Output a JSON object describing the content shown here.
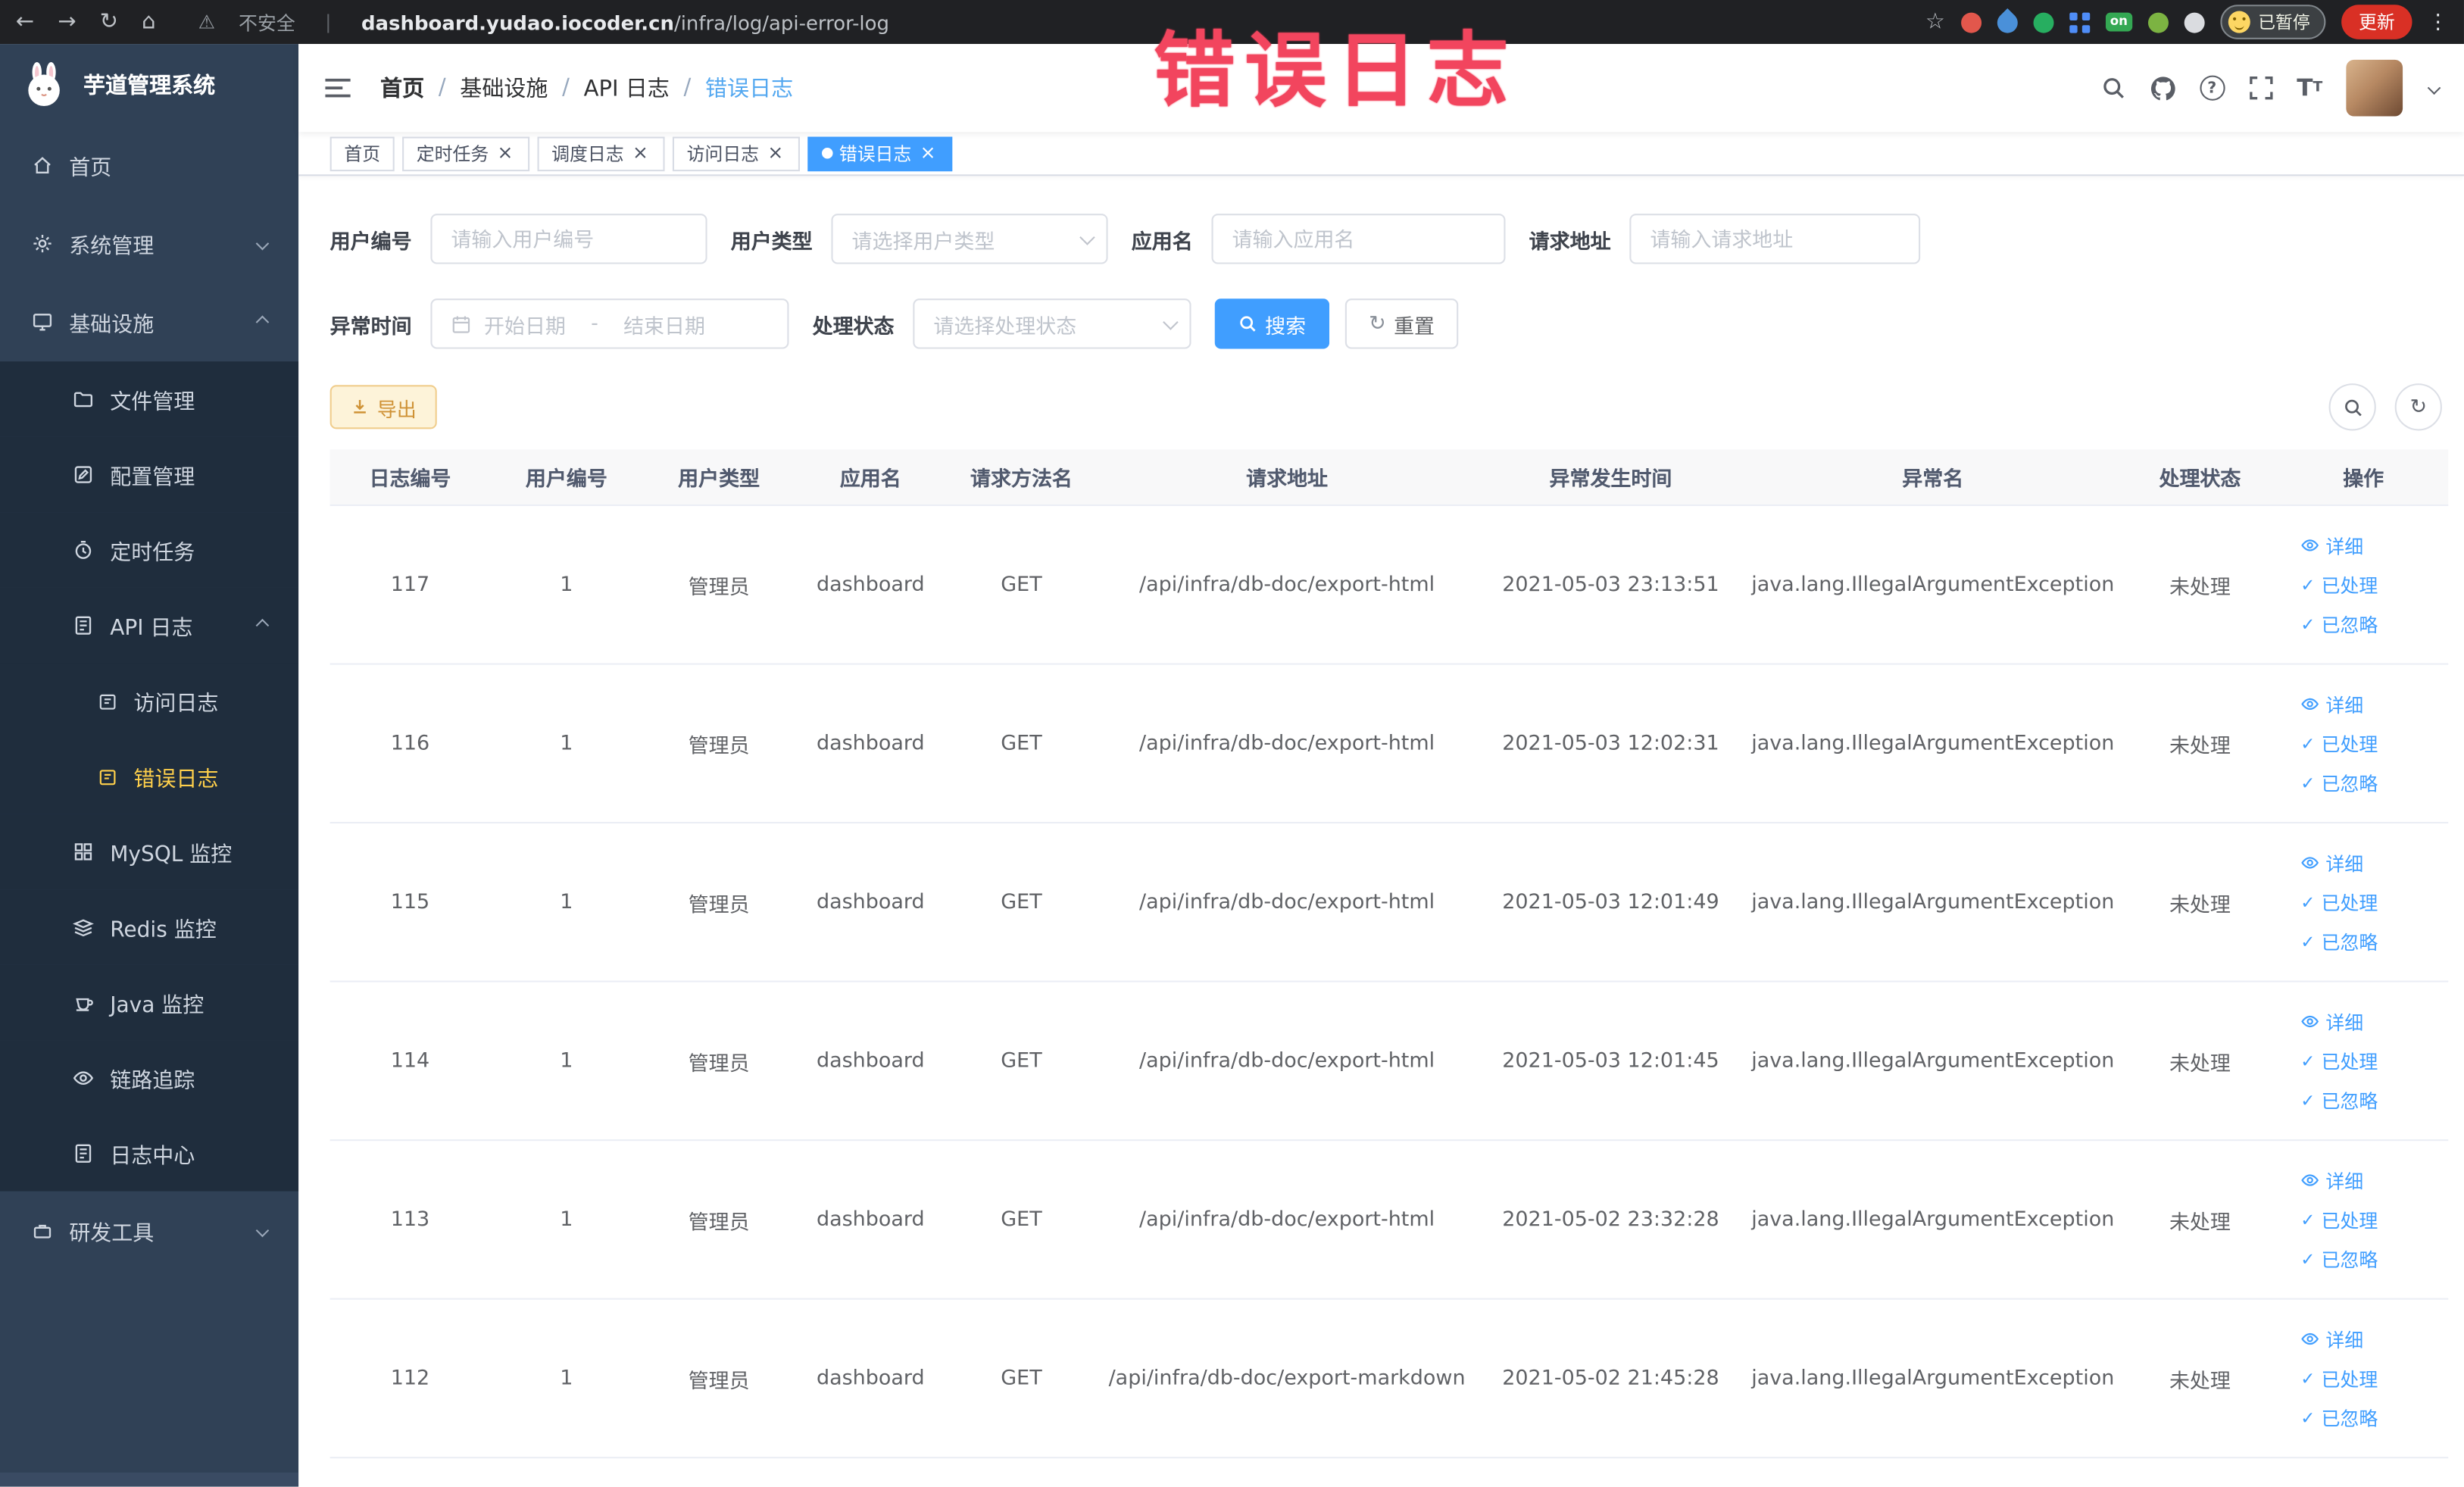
{
  "browser": {
    "security_label": "不安全",
    "url_domain": "dashboard.yudao.iocoder.cn",
    "url_path": "/infra/log/api-error-log",
    "paused_badge": "已暂停",
    "update_button": "更新",
    "extension_on_badge": "on"
  },
  "glyphs": {
    "back": "←",
    "forward": "→",
    "refresh": "↻",
    "home": "⌂",
    "warning": "⚠",
    "star": "☆",
    "menu_dots": "⋮",
    "close": "×",
    "check": "✓",
    "question": "?",
    "t": "T",
    "bar": "|"
  },
  "sidebar": {
    "logo_title": "芋道管理系统",
    "items": [
      {
        "label": "首页"
      },
      {
        "label": "系统管理"
      },
      {
        "label": "基础设施"
      },
      {
        "label": "文件管理"
      },
      {
        "label": "配置管理"
      },
      {
        "label": "定时任务"
      },
      {
        "label": "API 日志"
      },
      {
        "label": "访问日志"
      },
      {
        "label": "错误日志"
      },
      {
        "label": "MySQL 监控"
      },
      {
        "label": "Redis 监控"
      },
      {
        "label": "Java 监控"
      },
      {
        "label": "链路追踪"
      },
      {
        "label": "日志中心"
      },
      {
        "label": "研发工具"
      }
    ]
  },
  "header": {
    "breadcrumb": [
      "首页",
      "基础设施",
      "API 日志",
      "错误日志"
    ],
    "separator": "/"
  },
  "tabs": [
    {
      "label": "首页"
    },
    {
      "label": "定时任务"
    },
    {
      "label": "调度日志"
    },
    {
      "label": "访问日志"
    },
    {
      "label": "错误日志"
    }
  ],
  "watermark": "错误日志",
  "filters": {
    "user_id": {
      "label": "用户编号",
      "placeholder": "请输入用户编号"
    },
    "user_type": {
      "label": "用户类型",
      "placeholder": "请选择用户类型"
    },
    "app_name": {
      "label": "应用名",
      "placeholder": "请输入应用名"
    },
    "request_url": {
      "label": "请求地址",
      "placeholder": "请输入请求地址"
    },
    "exception_time": {
      "label": "异常时间",
      "start_placeholder": "开始日期",
      "separator": "-",
      "end_placeholder": "结束日期"
    },
    "process_status": {
      "label": "处理状态",
      "placeholder": "请选择处理状态"
    },
    "search_button": "搜索",
    "reset_button": "重置"
  },
  "toolbar": {
    "export_button": "导出"
  },
  "table": {
    "columns": [
      "日志编号",
      "用户编号",
      "用户类型",
      "应用名",
      "请求方法名",
      "请求地址",
      "异常发生时间",
      "异常名",
      "处理状态",
      "操作"
    ],
    "actions": [
      "详细",
      "已处理",
      "已忽略"
    ],
    "rows": [
      {
        "id": "117",
        "user_id": "1",
        "user_type": "管理员",
        "app": "dashboard",
        "method": "GET",
        "url": "/api/infra/db-doc/export-html",
        "time": "2021-05-03 23:13:51",
        "exception": "java.lang.IllegalArgumentException",
        "status": "未处理"
      },
      {
        "id": "116",
        "user_id": "1",
        "user_type": "管理员",
        "app": "dashboard",
        "method": "GET",
        "url": "/api/infra/db-doc/export-html",
        "time": "2021-05-03 12:02:31",
        "exception": "java.lang.IllegalArgumentException",
        "status": "未处理"
      },
      {
        "id": "115",
        "user_id": "1",
        "user_type": "管理员",
        "app": "dashboard",
        "method": "GET",
        "url": "/api/infra/db-doc/export-html",
        "time": "2021-05-03 12:01:49",
        "exception": "java.lang.IllegalArgumentException",
        "status": "未处理"
      },
      {
        "id": "114",
        "user_id": "1",
        "user_type": "管理员",
        "app": "dashboard",
        "method": "GET",
        "url": "/api/infra/db-doc/export-html",
        "time": "2021-05-03 12:01:45",
        "exception": "java.lang.IllegalArgumentException",
        "status": "未处理"
      },
      {
        "id": "113",
        "user_id": "1",
        "user_type": "管理员",
        "app": "dashboard",
        "method": "GET",
        "url": "/api/infra/db-doc/export-html",
        "time": "2021-05-02 23:32:28",
        "exception": "java.lang.IllegalArgumentException",
        "status": "未处理"
      },
      {
        "id": "112",
        "user_id": "1",
        "user_type": "管理员",
        "app": "dashboard",
        "method": "GET",
        "url": "/api/infra/db-doc/export-markdown",
        "time": "2021-05-02 21:45:28",
        "exception": "java.lang.IllegalArgumentException",
        "status": "未处理"
      }
    ]
  }
}
